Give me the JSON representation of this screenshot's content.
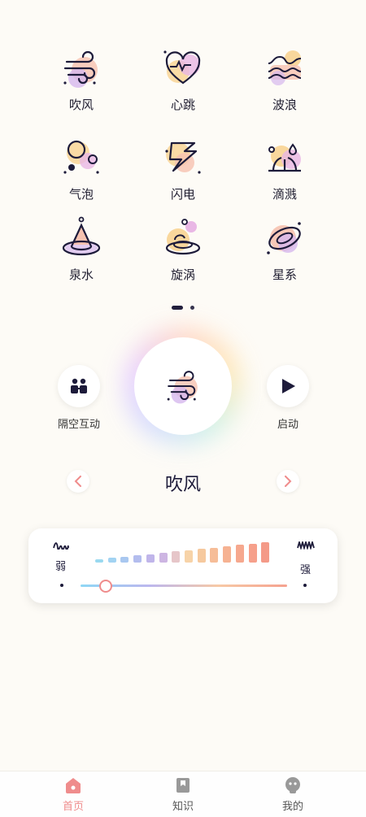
{
  "modes": [
    {
      "label": "吹风",
      "icon": "wind-icon"
    },
    {
      "label": "心跳",
      "icon": "heartbeat-icon"
    },
    {
      "label": "波浪",
      "icon": "wave-icon"
    },
    {
      "label": "气泡",
      "icon": "bubble-icon"
    },
    {
      "label": "闪电",
      "icon": "lightning-icon"
    },
    {
      "label": "滴溅",
      "icon": "splash-icon"
    },
    {
      "label": "泉水",
      "icon": "spring-icon"
    },
    {
      "label": "旋涡",
      "icon": "vortex-icon"
    },
    {
      "label": "星系",
      "icon": "galaxy-icon"
    }
  ],
  "pager": {
    "pages": 2,
    "current": 1
  },
  "left_action": {
    "label": "隔空互动",
    "icon": "people-icon"
  },
  "right_action": {
    "label": "启动",
    "icon": "play-icon"
  },
  "current_mode": {
    "label": "吹风",
    "icon": "wind-icon"
  },
  "intensity": {
    "min_label": "弱",
    "max_label": "强",
    "level_fraction": 0.12,
    "bar_count": 14
  },
  "tabs": [
    {
      "label": "首页",
      "icon": "home-icon",
      "active": true
    },
    {
      "label": "知识",
      "icon": "bookmark-icon",
      "active": false
    },
    {
      "label": "我的",
      "icon": "profile-icon",
      "active": false
    }
  ],
  "colors": {
    "accent": "#ef8c8c",
    "text": "#1d1b3a",
    "background": "#fdfbf6"
  }
}
